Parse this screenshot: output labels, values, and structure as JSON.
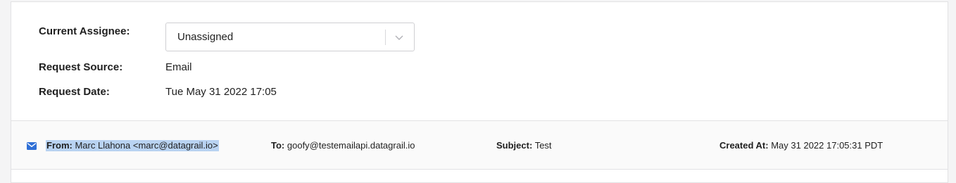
{
  "details": {
    "assignee_label": "Current Assignee:",
    "assignee_value": "Unassigned",
    "source_label": "Request Source:",
    "source_value": "Email",
    "date_label": "Request Date:",
    "date_value": "Tue May 31 2022 17:05"
  },
  "email": {
    "icon": "envelope-icon",
    "from_label": "From:",
    "from_value": "Marc Llahona <marc@datagrail.io>",
    "to_label": "To:",
    "to_value": "goofy@testemailapi.datagrail.io",
    "subject_label": "Subject:",
    "subject_value": "Test",
    "created_label": "Created At:",
    "created_value": "May 31 2022 17:05:31 PDT"
  },
  "colors": {
    "accent": "#2f6fd6",
    "selection": "#b9d3f2"
  }
}
